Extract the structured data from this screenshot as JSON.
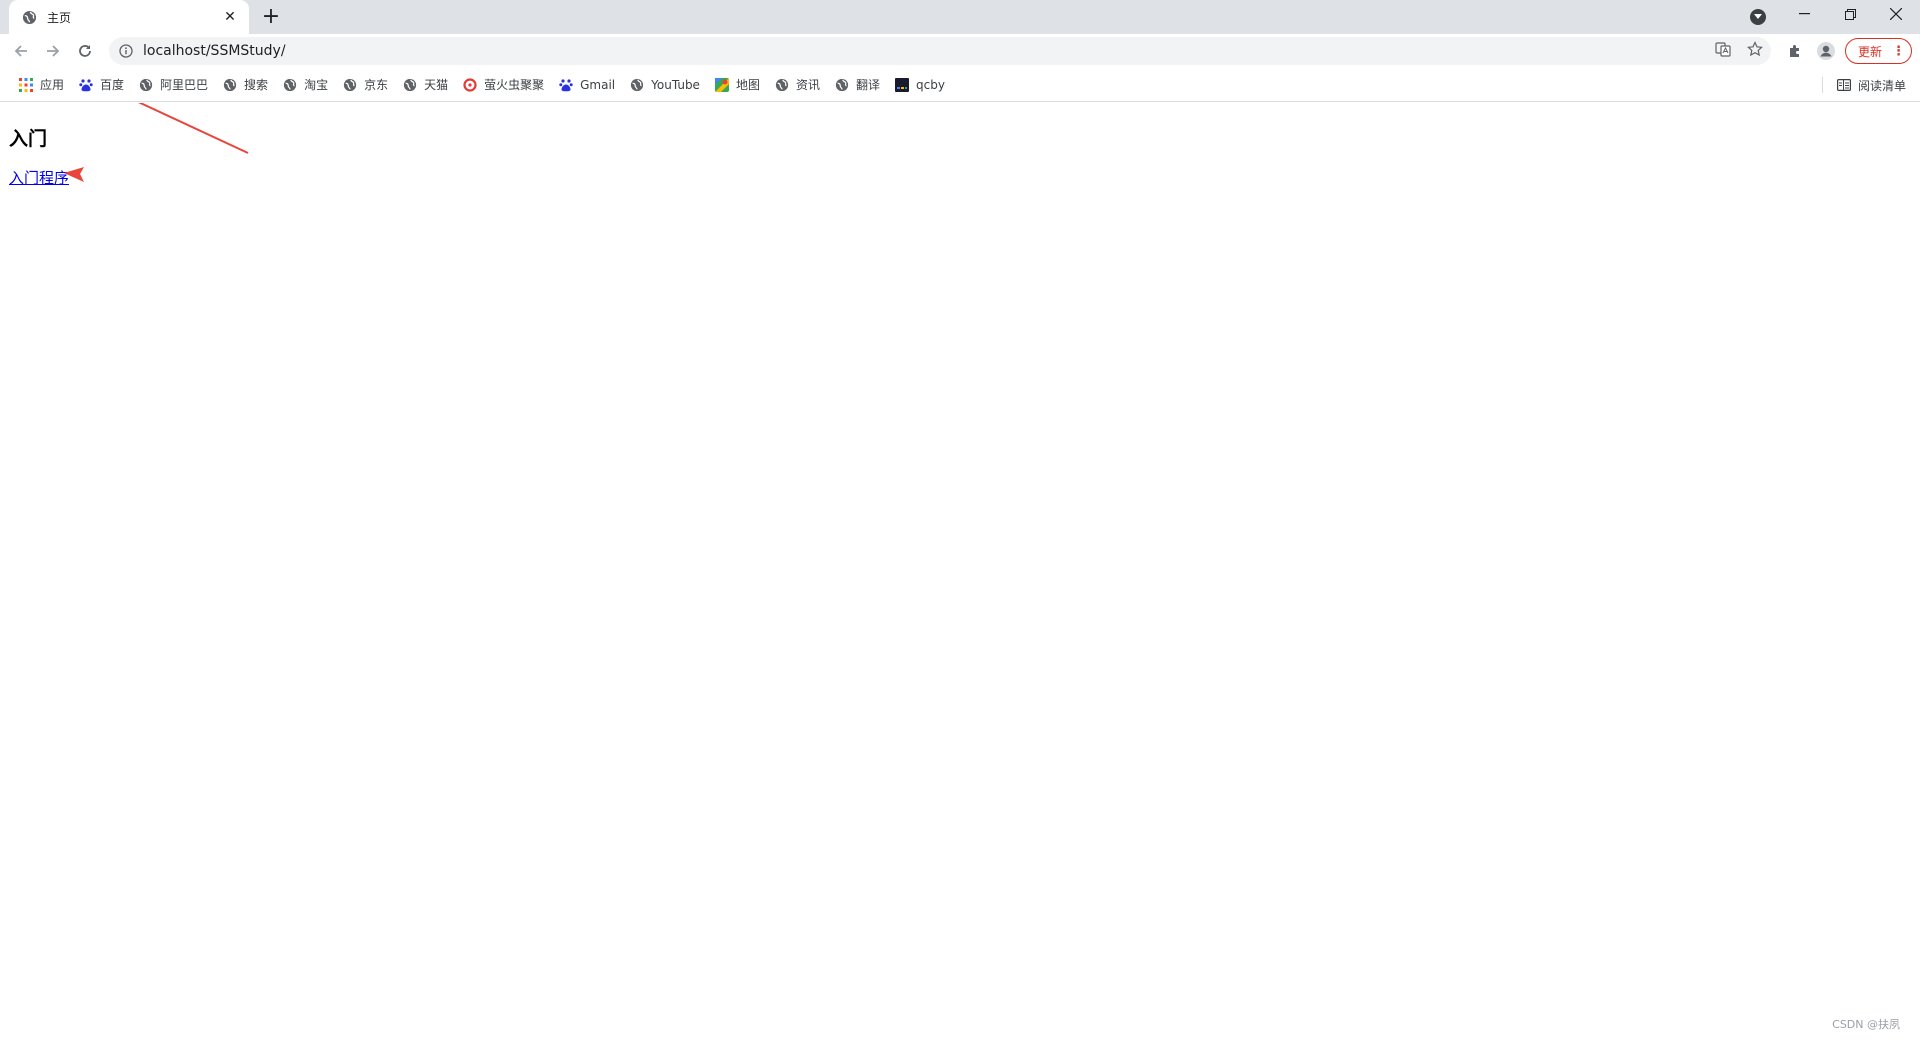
{
  "browser": {
    "tab": {
      "title": "主页",
      "favicon": "globe-icon"
    },
    "address": {
      "url": "localhost/SSMStudy/"
    },
    "update_label": "更新",
    "update_menu": "⋮"
  },
  "bookmarks": [
    {
      "label": "应用",
      "icon": "apps-grid-icon"
    },
    {
      "label": "百度",
      "icon": "baidu-paw-icon"
    },
    {
      "label": "阿里巴巴",
      "icon": "globe-icon"
    },
    {
      "label": "搜索",
      "icon": "globe-icon"
    },
    {
      "label": "淘宝",
      "icon": "globe-icon"
    },
    {
      "label": "京东",
      "icon": "globe-icon"
    },
    {
      "label": "天猫",
      "icon": "globe-icon"
    },
    {
      "label": "萤火虫聚聚",
      "icon": "flower-icon"
    },
    {
      "label": "Gmail",
      "icon": "baidu-paw-icon"
    },
    {
      "label": "YouTube",
      "icon": "globe-icon"
    },
    {
      "label": "地图",
      "icon": "maps-icon"
    },
    {
      "label": "资讯",
      "icon": "globe-icon"
    },
    {
      "label": "翻译",
      "icon": "globe-icon"
    },
    {
      "label": "qcby",
      "icon": "qcby-icon"
    }
  ],
  "reading_list": {
    "label": "阅读清单"
  },
  "page": {
    "heading": "入门",
    "link": "入门程序"
  },
  "watermark": "CSDN @扶夙",
  "colors": {
    "annotation_arrow": "#e8453c",
    "link": "#0000ee",
    "update_accent": "#d93025"
  }
}
